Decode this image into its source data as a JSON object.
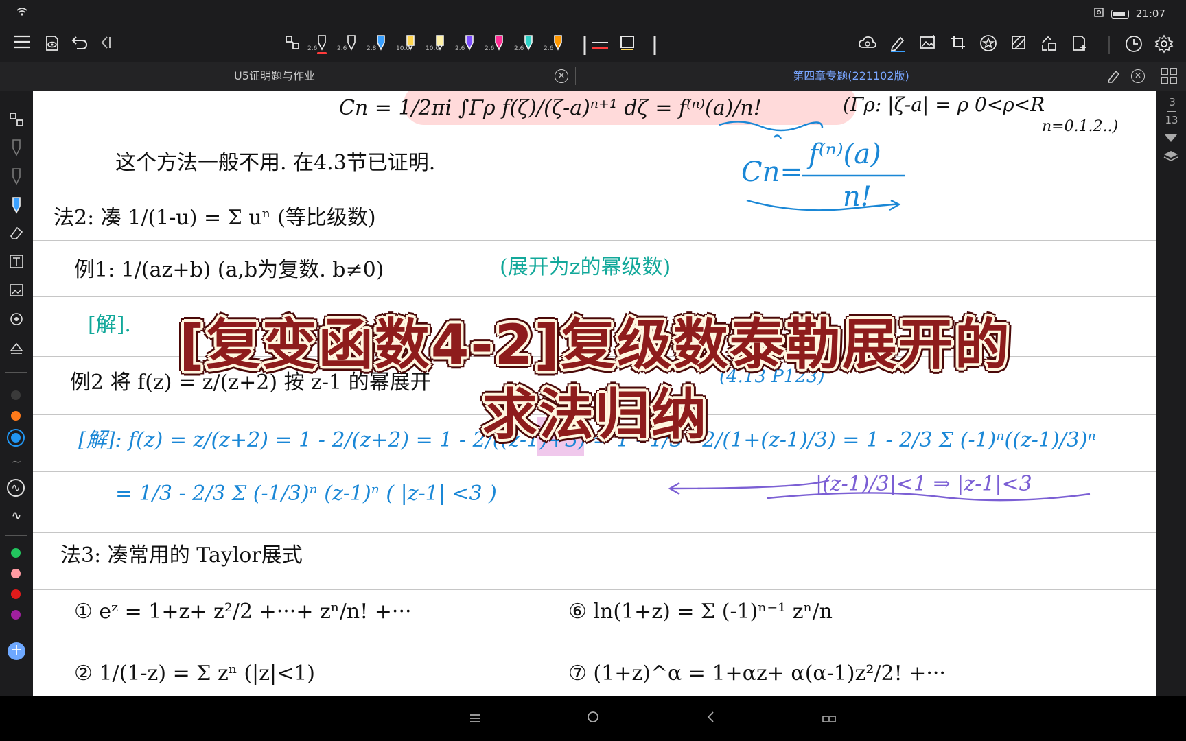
{
  "status": {
    "time": "21:07"
  },
  "toolbar": {
    "pen_sizes": [
      "2.6",
      "2.6",
      "2.8",
      "10.0",
      "10.0",
      "2.6",
      "2.6",
      "2.6",
      "2.6"
    ],
    "pen_colors": [
      "#ff3b3b",
      "#ffffff",
      "#3aa0ff",
      "#ffd54f",
      "#ffd54f",
      "#7c4dff",
      "#ff2d95",
      "#2ed1c6",
      "#ff9800"
    ]
  },
  "tabs": [
    {
      "label": "U5证明题与作业"
    },
    {
      "label": "第四章专题(221102版)"
    }
  ],
  "page_indicator": {
    "current": "3",
    "total": "13"
  },
  "sidebar_colors": [
    "#3a3a3a",
    "#ff7a1a",
    "#2196f3",
    "#22c55e",
    "#ff9aa2",
    "#e01b1b",
    "#a020a0"
  ],
  "notes": {
    "line1": "Cn = 1/2πi ∫Γρ f(ζ)/(ζ-a)ⁿ⁺¹ dζ = f⁽ⁿ⁾(a)/n!",
    "line1_cond": "(Γρ: |ζ-a| = ρ  0<ρ<R",
    "line1_cond2": "n=0.1.2..)",
    "cn_formula_num": "f⁽ⁿ⁾(a)",
    "cn_formula_left": "Cn=",
    "cn_formula_den": "n!",
    "line2": "这个方法一般不用. 在4.3节已证明.",
    "line3": "法2:  凑  1/(1-u) = Σ uⁿ   (等比级数)",
    "line4": "例1:   1/(az+b)   (a,b为复数. b≠0)",
    "line4b": "(展开为z的幂级数)",
    "line5": "[解].",
    "line6": "例2  将 f(z) = z/(z+2) 按 z-1 的幂展开",
    "line6b": "(4.13  P123)",
    "line7": "[解]: f(z) = z/(z+2) = 1 - 2/(z+2) = 1 - 2/((z-1)+3) = 1 - 1/3 · 2/(1+(z-1)/3) = 1 - 2/3 Σ (-1)ⁿ((z-1)/3)ⁿ",
    "line8": "= 1/3 - 2/3 Σ (-1/3)ⁿ (z-1)ⁿ      ( |z-1| <3 )",
    "line8b": "|(z-1)/3|<1  ⇒  |z-1|<3",
    "line9": "法3:   凑常用的 Taylor展式",
    "line10a": "① eᶻ = 1+z+ z²/2 +···+ zⁿ/n! +···",
    "line10b": "⑥ ln(1+z) = Σ (-1)ⁿ⁻¹ zⁿ/n",
    "line11a": "② 1/(1-z) = Σ zⁿ  (|z|<1)",
    "line11b": "⑦ (1+z)^α = 1+αz+ α(α-1)z²/2! +···"
  },
  "overlay_title": {
    "line1": "[复变函数4-2]复级数泰勒展开的",
    "line2": "求法归纳"
  }
}
